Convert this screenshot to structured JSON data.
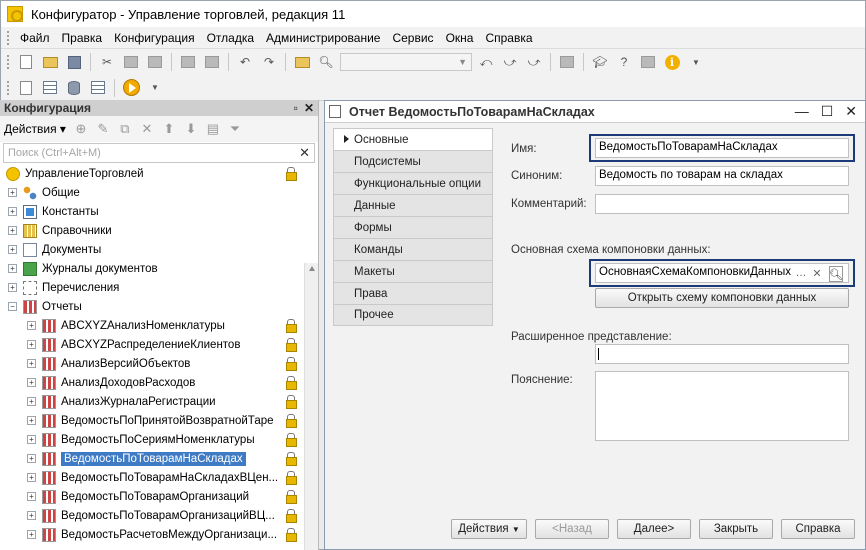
{
  "window": {
    "title": "Конфигуратор - Управление торговлей, редакция 11"
  },
  "menu": [
    "Файл",
    "Правка",
    "Конфигурация",
    "Отладка",
    "Администрирование",
    "Сервис",
    "Окна",
    "Справка"
  ],
  "left_panel": {
    "title": "Конфигурация",
    "actions_label": "Действия",
    "search_placeholder": "Поиск (Ctrl+Alt+M)",
    "root": "УправлениеТорговлей",
    "groups": [
      "Общие",
      "Константы",
      "Справочники",
      "Документы",
      "Журналы документов",
      "Перечисления",
      "Отчеты"
    ],
    "reports": [
      "ABCXYZАнализНоменклатуры",
      "ABCXYZРаспределениеКлиентов",
      "АнализВерсийОбъектов",
      "АнализДоходовРасходов",
      "АнализЖурналаРегистрации",
      "ВедомостьПоПринятойВозвратнойТаре",
      "ВедомостьПоСериямНоменклатуры",
      "ВедомостьПоТоварамНаСкладах",
      "ВедомостьПоТоварамНаСкладахВЦен...",
      "ВедомостьПоТоварамОрганизаций",
      "ВедомостьПоТоварамОрганизацийВЦ...",
      "ВедомостьРасчетовМеждуОрганизаци..."
    ]
  },
  "dialog": {
    "title": "Отчет ВедомостьПоТоварамНаСкладах",
    "tabs": [
      "Основные",
      "Подсистемы",
      "Функциональные опции",
      "Данные",
      "Формы",
      "Команды",
      "Макеты",
      "Права",
      "Прочее"
    ],
    "labels": {
      "name": "Имя:",
      "synonym": "Синоним:",
      "comment": "Комментарий:",
      "schema": "Основная схема компоновки данных:",
      "extended": "Расширенное представление:",
      "explanation": "Пояснение:"
    },
    "values": {
      "name": "ВедомостьПоТоварамНаСкладах",
      "synonym": "Ведомость по товарам на складах",
      "comment": "",
      "schema": "ОсновнаяСхемаКомпоновкиДанных",
      "extended": "",
      "explanation": ""
    },
    "open_schema_button": "Открыть схему компоновки данных",
    "buttons": {
      "actions": "Действия",
      "back": "<Назад",
      "next": "Далее>",
      "close": "Закрыть",
      "help": "Справка"
    }
  }
}
